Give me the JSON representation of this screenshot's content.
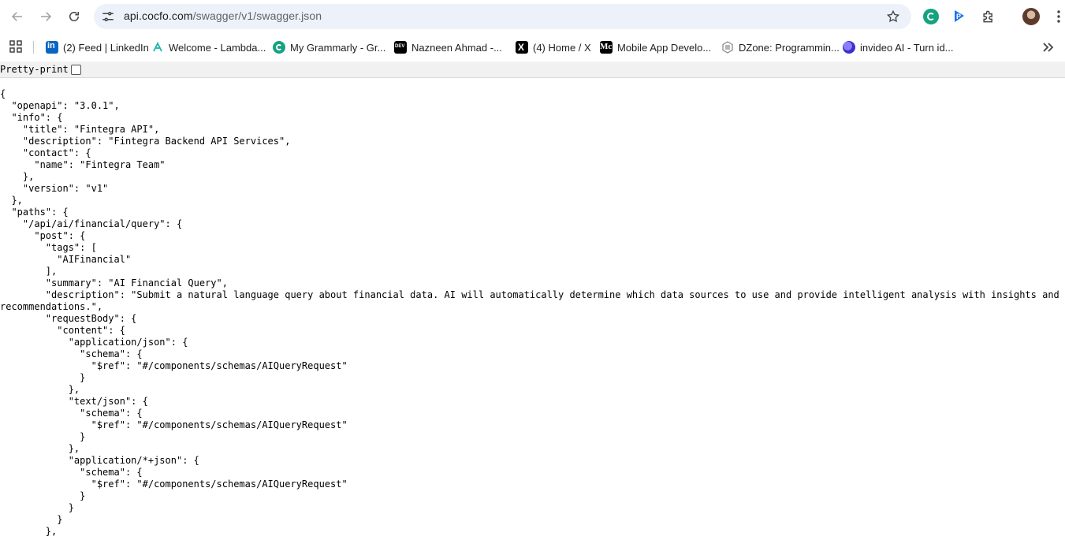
{
  "browser": {
    "url_host": "api.cocfo.com",
    "url_path": "/swagger/v1/swagger.json"
  },
  "toolbar": {
    "icons": [
      "back-icon",
      "forward-icon",
      "reload-icon",
      "site-settings-icon",
      "bookmark-star-icon",
      "grammarly-extension-icon",
      "p-extension-icon",
      "extensions-puzzle-icon",
      "profile-avatar",
      "more-menu-icon"
    ]
  },
  "bookmarks": {
    "items": [
      {
        "label": "(2) Feed | LinkedIn",
        "icon": "linkedin-icon"
      },
      {
        "label": "Welcome - Lambda...",
        "icon": "lambdatest-icon"
      },
      {
        "label": "My Grammarly - Gr...",
        "icon": "grammarly-icon"
      },
      {
        "label": "Nazneen Ahmad -...",
        "icon": "dev-icon"
      },
      {
        "label": "(4) Home / X",
        "icon": "x-icon"
      },
      {
        "label": "Mobile App Develo...",
        "icon": "mc-icon"
      },
      {
        "label": "DZone: Programmin...",
        "icon": "dzone-icon"
      },
      {
        "label": "invideo AI - Turn id...",
        "icon": "invideo-icon"
      }
    ]
  },
  "viewer": {
    "pretty_print_label": "Pretty-print",
    "pretty_print_checked": false
  },
  "json_lines": [
    "{",
    "  \"openapi\": \"3.0.1\",",
    "  \"info\": {",
    "    \"title\": \"Fintegra API\",",
    "    \"description\": \"Fintegra Backend API Services\",",
    "    \"contact\": {",
    "      \"name\": \"Fintegra Team\"",
    "    },",
    "    \"version\": \"v1\"",
    "  },",
    "  \"paths\": {",
    "    \"/api/ai/financial/query\": {",
    "      \"post\": {",
    "        \"tags\": [",
    "          \"AIFinancial\"",
    "        ],",
    "        \"summary\": \"AI Financial Query\",",
    "        \"description\": \"Submit a natural language query about financial data. AI will automatically determine which data sources to use and provide intelligent analysis with insights and",
    "recommendations.\",",
    "        \"requestBody\": {",
    "          \"content\": {",
    "            \"application/json\": {",
    "              \"schema\": {",
    "                \"$ref\": \"#/components/schemas/AIQueryRequest\"",
    "              }",
    "            },",
    "            \"text/json\": {",
    "              \"schema\": {",
    "                \"$ref\": \"#/components/schemas/AIQueryRequest\"",
    "              }",
    "            },",
    "            \"application/*+json\": {",
    "              \"schema\": {",
    "                \"$ref\": \"#/components/schemas/AIQueryRequest\"",
    "              }",
    "            }",
    "          }",
    "        },"
  ]
}
